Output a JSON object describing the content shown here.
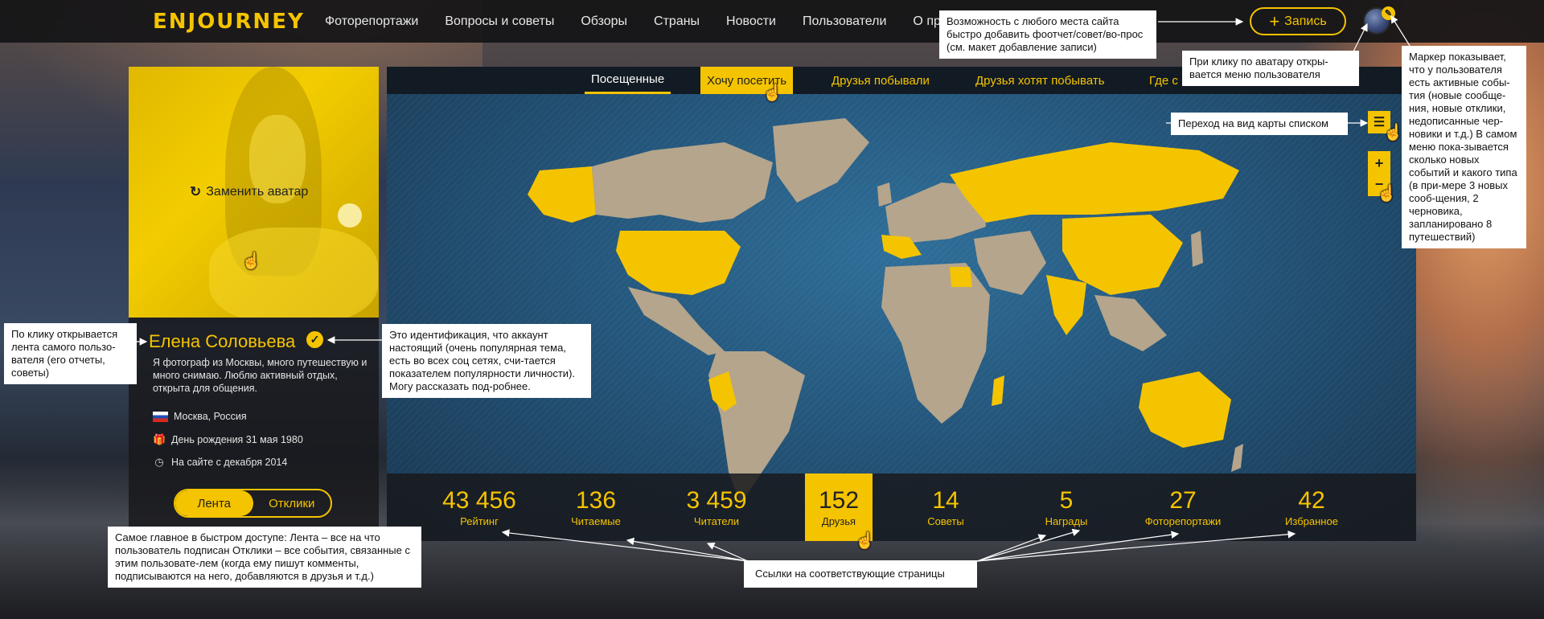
{
  "nav": {
    "logo": "ENJOURNEY",
    "links": [
      "Фоторепортажи",
      "Вопросы и советы",
      "Обзоры",
      "Страны",
      "Новости",
      "Пользователи",
      "О проек"
    ],
    "write_label": "Запись",
    "write_icon": "plus-icon"
  },
  "profile": {
    "replace_avatar_label": "Заменить аватар",
    "name": "Елена Соловьева",
    "bio": "Я фотограф из Москвы, много путешествую и много снимаю. Люблю активный отдых, открыта для общения.",
    "location": "Москва, Россия",
    "birthday": "День рождения 31 мая 1980",
    "since": "На сайте с декабря 2014",
    "tabs": {
      "feed": "Лента",
      "responses": "Отклики"
    }
  },
  "map": {
    "tabs": [
      "Посещенные",
      "Хочу посетить",
      "Друзья побывали",
      "Друзья хотят побывать",
      "Где с"
    ],
    "active_tab": "Посещенные",
    "hover_tab": "Хочу посетить",
    "colors": {
      "accent": "#f5c400",
      "land": "#b5a58c",
      "ocean": "#24557a"
    }
  },
  "stats": [
    {
      "value": "43 456",
      "label": "Рейтинг"
    },
    {
      "value": "136",
      "label": "Читаемые"
    },
    {
      "value": "3 459",
      "label": "Читатели"
    },
    {
      "value": "152",
      "label": "Друзья"
    },
    {
      "value": "14",
      "label": "Советы"
    },
    {
      "value": "5",
      "label": "Награды"
    },
    {
      "value": "27",
      "label": "Фоторепортажи"
    },
    {
      "value": "42",
      "label": "Избранное"
    }
  ],
  "notes": {
    "add_anywhere": "Возможность с любого места сайта быстро добавить фоотчет/совет/во-прос (см. макет добавление записи)",
    "avatar_menu": "При клику по аватару откры-вается меню пользователя",
    "marker": "Маркер показывает, что у пользователя есть активные собы-тия (новые сообще-ния, новые отклики, недописанные чер-новики и т.д.) В самом меню пока-зывается сколько новых событий и какого типа (в при-мере 3 новых сооб-щения, 2 черновика, запланировано 8 путешествий)",
    "list_view": "Переход на вид карты списком",
    "feed_click": "По клику открывается лента самого пользо-вателя (его отчеты, советы)",
    "verified": "Это идентификация, что аккаунт настоящий (очень популярная тема, есть во всех соц сетях, счи-тается показателем популярности личности). Могу рассказать под-робнее.",
    "quick_access": "Самое главное в быстром доступе: Лента – все на что пользователь подписан Отклики – все события, связанные с этим пользовате-лем (когда ему пишут комменты, подписываются на него, добавляются в друзья и т.д.)",
    "links": "Ссылки на соответствующие страницы"
  }
}
